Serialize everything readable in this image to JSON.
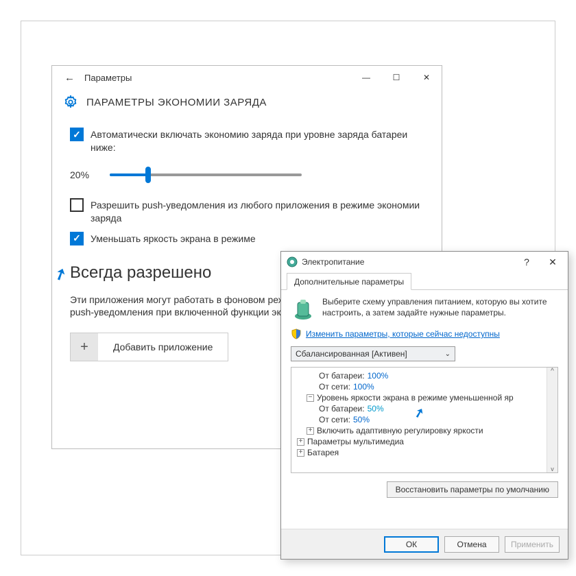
{
  "settings": {
    "window_title": "Параметры",
    "heading": "ПАРАМЕТРЫ ЭКОНОМИИ ЗАРЯДА",
    "checkbox_auto": "Автоматически включать экономию заряда при уровне заряда батареи ниже:",
    "slider_value": "20%",
    "slider_percent": 20,
    "checkbox_push": "Разрешить push-уведомления из любого приложения в режиме экономии заряда",
    "checkbox_dim": "Уменьшать яркость экрана в режиме",
    "section_heading": "Всегда разрешено",
    "section_text": "Эти приложения могут работать в фоновом режиме, отправлять и принимать push-уведомления при включенной функции экономии заряда.",
    "add_button": "Добавить приложение"
  },
  "power": {
    "title": "Электропитание",
    "tab": "Дополнительные параметры",
    "description": "Выберите схему управления питанием, которую вы хотите настроить, а затем задайте нужные параметры.",
    "admin_link": "Изменить параметры, которые сейчас недоступны",
    "scheme_selected": "Сбалансированная [Активен]",
    "tree": {
      "r1_label": "От батареи:",
      "r1_val": "100%",
      "r2_label": "От сети:",
      "r2_val": "100%",
      "r3_label": "Уровень яркости экрана в режиме уменьшенной яр",
      "r4_label": "От батареи:",
      "r4_val": "50%",
      "r5_label": "От сети:",
      "r5_val": "50%",
      "r6_label": "Включить адаптивную регулировку яркости",
      "r7_label": "Параметры мультимедиа",
      "r8_label": "Батарея"
    },
    "restore": "Восстановить параметры по умолчанию",
    "ok": "ОК",
    "cancel": "Отмена",
    "apply": "Применить"
  }
}
